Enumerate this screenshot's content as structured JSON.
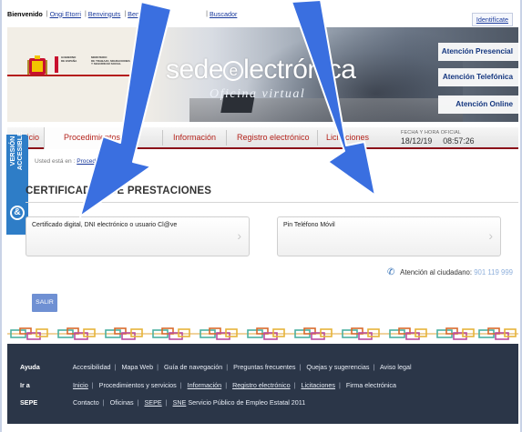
{
  "topbar": {
    "languages": [
      "Bienvenido",
      "Ongi Etorri",
      "Benvinguts",
      "Benvido"
    ],
    "search_label": "Buscador",
    "identify_label": "Identifícate"
  },
  "banner": {
    "gov_line1": "GOBIERNO",
    "gov_line2": "DE ESPAÑA",
    "ministry_line1": "MINISTERIO",
    "ministry_line2": "DE TRABAJO, MIGRACIONES",
    "ministry_line3": "Y SEGURIDAD SOCIAL",
    "logo_main_pre": "sede",
    "logo_main_e": "e",
    "logo_main_post": "lectrónica",
    "logo_sub": "Oficina virtual",
    "attention": [
      "Atención Presencial",
      "Atención Telefónica",
      "Atención Online"
    ]
  },
  "nav": {
    "items": [
      "Inicio",
      "Procedimientos",
      "Información",
      "Registro electrónico",
      "Licitaciones"
    ],
    "datetime_label": "FECHA Y HORA OFICIAL",
    "date": "18/12/19",
    "time": "08:57:26"
  },
  "accessible": {
    "line1": "VERSIÓN",
    "line2": "ACCESIBLE"
  },
  "breadcrumb": {
    "prefix": "Usted está en :",
    "link": "Procedimientos"
  },
  "main": {
    "title": "CERTIFICADOS DE PRESTACIONES",
    "cards": [
      "Certificado digital, DNI electrónico o usuario Cl@ve",
      "Pin Teléfono Móvil"
    ],
    "citizen_label": "Atención al ciudadano:",
    "citizen_phone": "901 119 999",
    "exit_label": "SALIR"
  },
  "footer": {
    "rows": [
      {
        "label": "Ayuda",
        "links": [
          "Accesibilidad",
          "Mapa Web",
          "Guía de navegación",
          "Preguntas frecuentes",
          "Quejas y sugerencias",
          "Aviso legal"
        ]
      },
      {
        "label": "Ir a",
        "links": [
          "Inicio",
          "Procedimientos y servicios",
          "Información",
          "Registro electrónico",
          "Licitaciones",
          "Firma electrónica"
        ]
      },
      {
        "label": "SEPE",
        "links": [
          "Contacto",
          "Oficinas",
          "SEPE",
          "SNE",
          "Servicio Público de Empleo Estatal 2011"
        ]
      }
    ]
  },
  "colors": {
    "nav_text": "#b4231c",
    "nav_border": "#8a0f18",
    "accessible_tab": "#2e7dc7",
    "footer_bg": "#2b3648",
    "arrow": "#3a6fe0",
    "exit_button": "#6f90d3"
  },
  "icons": {
    "phone": "phone-icon",
    "chevron": "chevron-right-icon",
    "accessibility": "accessibility-icon",
    "arrow": "arrow-down-icon"
  }
}
